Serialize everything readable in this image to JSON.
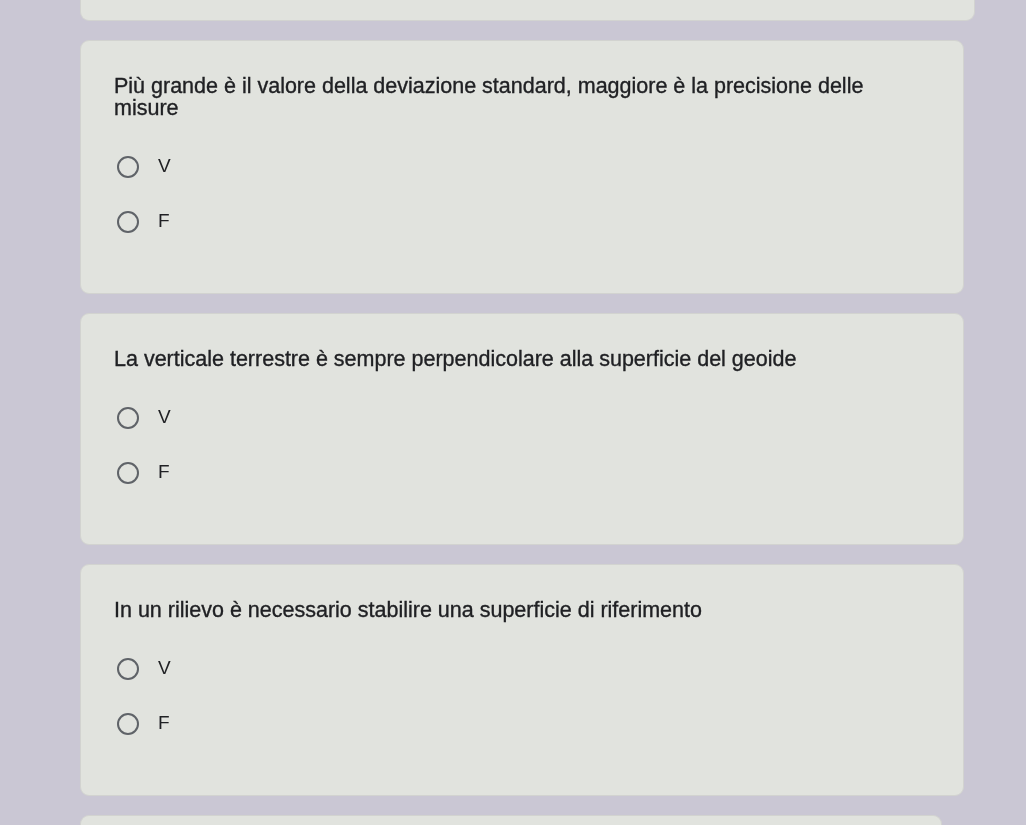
{
  "questions": [
    {
      "text": "Più grande è il valore della deviazione standard, maggiore è la precisione delle misure",
      "options": [
        {
          "label": "V",
          "selected": false
        },
        {
          "label": "F",
          "selected": false
        }
      ]
    },
    {
      "text": "La verticale terrestre è sempre perpendicolare alla superficie del geoide",
      "options": [
        {
          "label": "V",
          "selected": false
        },
        {
          "label": "F",
          "selected": false
        }
      ]
    },
    {
      "text": "In un rilievo è necessario stabilire una superficie di riferimento",
      "options": [
        {
          "label": "V",
          "selected": false
        },
        {
          "label": "F",
          "selected": false
        }
      ]
    }
  ]
}
